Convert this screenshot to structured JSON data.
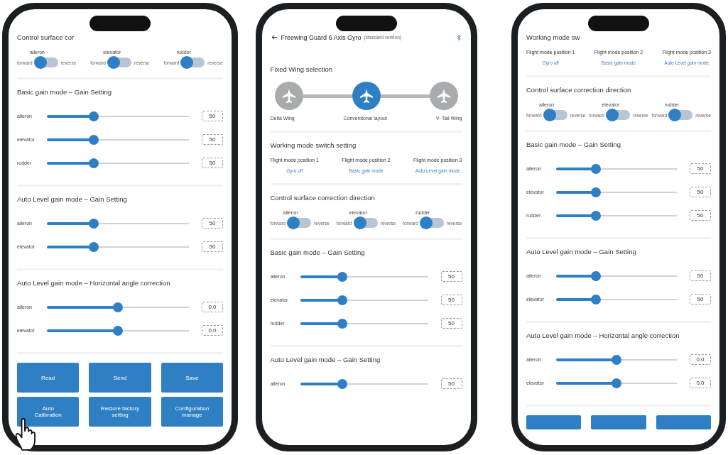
{
  "phones": [
    {
      "sections": [
        {
          "kind": "switches",
          "title": "Control surface cor",
          "items": [
            {
              "label": "aileron",
              "left": "forward",
              "right": "reverse",
              "on": false
            },
            {
              "label": "elevator",
              "left": "forward",
              "right": "reverse",
              "on": false
            },
            {
              "label": "rudder",
              "left": "forward",
              "right": "reverse",
              "on": false
            }
          ]
        },
        {
          "kind": "sliders",
          "title": "Basic gain mode – Gain Setting",
          "items": [
            {
              "label": "aileron",
              "level": 0.33,
              "value": "50"
            },
            {
              "label": "elevator",
              "level": 0.33,
              "value": "50"
            },
            {
              "label": "rudder",
              "level": 0.33,
              "value": "50"
            }
          ]
        },
        {
          "kind": "sliders",
          "title": "Auto Level gain mode – Gain Setting",
          "items": [
            {
              "label": "aileron",
              "level": 0.33,
              "value": "50"
            },
            {
              "label": "elevator",
              "level": 0.33,
              "value": "50"
            }
          ]
        },
        {
          "kind": "sliders",
          "title": "Auto Level gain mode – Horizontal angle correction",
          "items": [
            {
              "label": "aileron",
              "level": 0.5,
              "value": "0.0"
            },
            {
              "label": "elevator",
              "level": 0.5,
              "value": "0.0"
            }
          ]
        },
        {
          "kind": "buttons",
          "items": [
            "Read",
            "Send",
            "Save",
            "Auto Calibration",
            "Restore factory setting",
            "Configuration manage"
          ]
        }
      ],
      "hand": true
    },
    {
      "header": {
        "title": "Freewing Guard 6 Axis Gyro",
        "subtitle": "(standard version)"
      },
      "sections": [
        {
          "kind": "wings",
          "title": "Fixed Wing selection",
          "items": [
            {
              "label": "Delta Wing",
              "selected": false
            },
            {
              "label": "Conventional layout",
              "selected": true
            },
            {
              "label": "V- Tail Wing",
              "selected": false
            }
          ]
        },
        {
          "kind": "modes",
          "title": "Working mode switch setting",
          "items": [
            {
              "position": "Flight mode position 1",
              "mode": "Gyro off"
            },
            {
              "position": "Flight mode position 2",
              "mode": "Basic gain mode"
            },
            {
              "position": "Flight mode position 3",
              "mode": "Auto Level gain mode"
            }
          ]
        },
        {
          "kind": "switches",
          "title": "Control surface correction direction",
          "items": [
            {
              "label": "aileron",
              "left": "forward",
              "right": "reverse",
              "on": false
            },
            {
              "label": "elevator",
              "left": "forward",
              "right": "reverse",
              "on": false
            },
            {
              "label": "rudder",
              "left": "forward",
              "right": "reverse",
              "on": false
            }
          ]
        },
        {
          "kind": "sliders",
          "title": "Basic gain mode – Gain Setting",
          "items": [
            {
              "label": "aileron",
              "level": 0.33,
              "value": "50"
            },
            {
              "label": "elevator",
              "level": 0.33,
              "value": "50"
            },
            {
              "label": "rudder",
              "level": 0.33,
              "value": "50"
            }
          ]
        },
        {
          "kind": "sliders",
          "title": "Auto Level gain mode – Gain Setting",
          "items": [
            {
              "label": "aileron",
              "level": 0.33,
              "value": "50"
            }
          ]
        }
      ]
    },
    {
      "sections": [
        {
          "kind": "modes",
          "title": "Working mode sw",
          "items": [
            {
              "position": "Flight mode position 1",
              "mode": "Gyro off"
            },
            {
              "position": "Flight mode position 2",
              "mode": "Basic gain mode"
            },
            {
              "position": "Flight mode position 3",
              "mode": "Auto Level gain mode"
            }
          ]
        },
        {
          "kind": "switches",
          "title": "Control surface correction direction",
          "items": [
            {
              "label": "aileron",
              "left": "forward",
              "right": "reverse",
              "on": false
            },
            {
              "label": "elevator",
              "left": "forward",
              "right": "reverse",
              "on": false
            },
            {
              "label": "rudder",
              "left": "forward",
              "right": "reverse",
              "on": false
            }
          ]
        },
        {
          "kind": "sliders",
          "title": "Basic gain mode – Gain Setting",
          "items": [
            {
              "label": "aileron",
              "level": 0.33,
              "value": "50"
            },
            {
              "label": "elevator",
              "level": 0.33,
              "value": "50"
            },
            {
              "label": "rudder",
              "level": 0.33,
              "value": "50"
            }
          ]
        },
        {
          "kind": "sliders",
          "title": "Auto Level gain mode – Gain Setting",
          "items": [
            {
              "label": "aileron",
              "level": 0.33,
              "value": "50"
            },
            {
              "label": "elevator",
              "level": 0.33,
              "value": "50"
            }
          ]
        },
        {
          "kind": "sliders",
          "title": "Auto Level gain mode – Horizontal angle correction",
          "items": [
            {
              "label": "aileron",
              "level": 0.5,
              "value": "0.0"
            },
            {
              "label": "elevator",
              "level": 0.5,
              "value": "0.0"
            }
          ]
        },
        {
          "kind": "button_strip"
        }
      ]
    }
  ]
}
